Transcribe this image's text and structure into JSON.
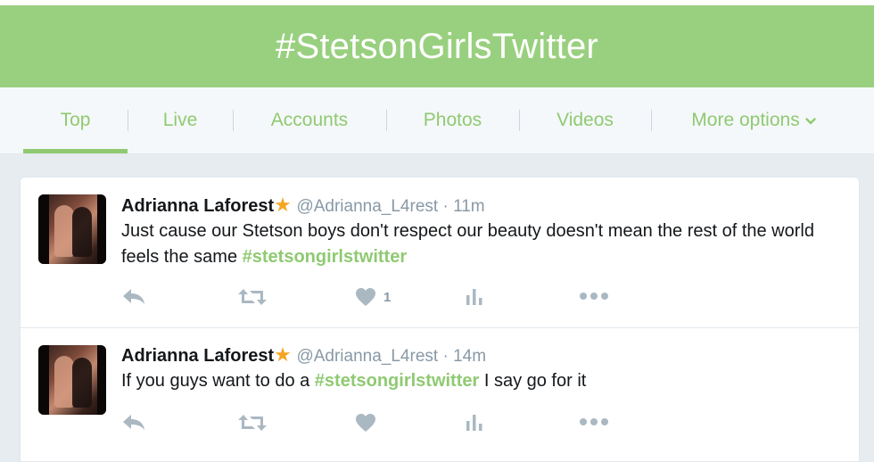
{
  "header": {
    "title": "#StetsonGirlsTwitter"
  },
  "tabs": [
    {
      "label": "Top"
    },
    {
      "label": "Live"
    },
    {
      "label": "Accounts"
    },
    {
      "label": "Photos"
    },
    {
      "label": "Videos"
    },
    {
      "label": "More options"
    }
  ],
  "tweets": [
    {
      "name": "Adrianna Laforest",
      "badge": "★",
      "handle": "@Adrianna_L4rest",
      "sep": " · ",
      "time": "11m",
      "text_before": "Just cause our Stetson boys don't respect our beauty doesn't mean the rest of the world feels the same ",
      "hashtag": "#stetsongirlstwitter",
      "text_after": "",
      "like_count": "1"
    },
    {
      "name": "Adrianna Laforest",
      "badge": "★",
      "handle": "@Adrianna_L4rest",
      "sep": " · ",
      "time": "14m",
      "text_before": "If you guys want to do a ",
      "hashtag": "#stetsongirlstwitter",
      "text_after": " I say go for it",
      "like_count": ""
    }
  ],
  "colors": {
    "accent": "#8fca72",
    "header_bg": "#99d07f",
    "star": "#f5a623"
  },
  "icons": [
    "reply-icon",
    "retweet-icon",
    "heart-icon",
    "analytics-icon",
    "more-icon",
    "chevron-down-icon"
  ]
}
